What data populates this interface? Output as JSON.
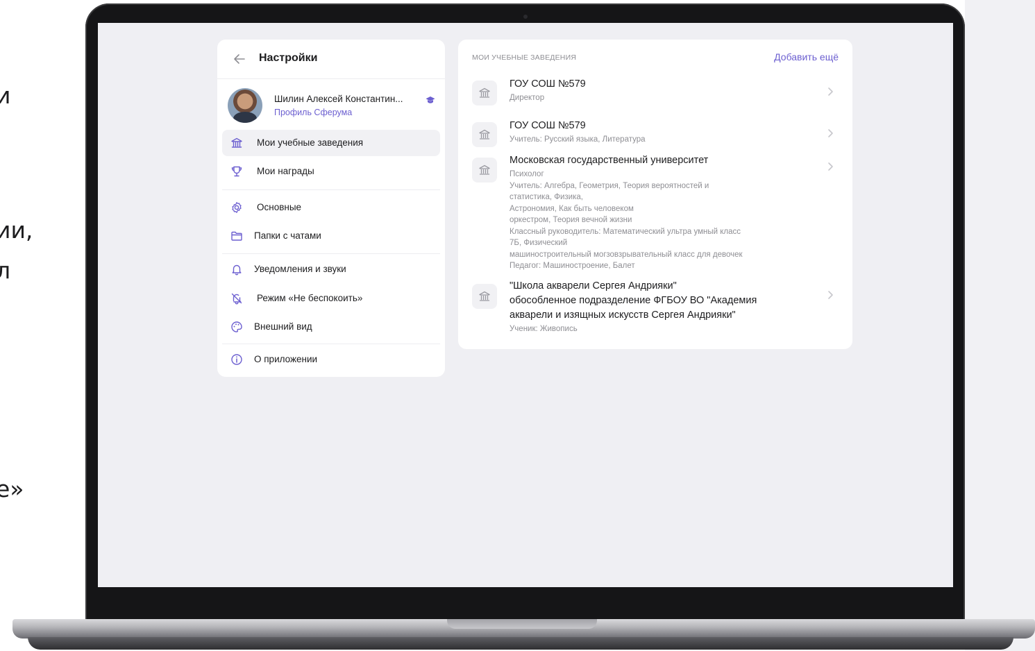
{
  "background_fragments": [
    "и",
    "ии,",
    "л",
    "е»"
  ],
  "settings": {
    "title": "Настройки",
    "user_name": "Шилин Алексей Константин...",
    "profile_link": "Профиль Сферума",
    "menu": [
      {
        "label": "Мои учебные заведения",
        "icon": "school-icon",
        "active": true
      },
      {
        "label": "Мои награды",
        "icon": "trophy-icon"
      },
      {
        "label": "Основные",
        "icon": "gear-icon"
      },
      {
        "label": "Папки с чатами",
        "icon": "folder-icon"
      },
      {
        "label": "Уведомления и звуки",
        "icon": "bell-icon"
      },
      {
        "label": "Режим «Не беспокоить»",
        "icon": "bell-off-icon"
      },
      {
        "label": "Внешний вид",
        "icon": "palette-icon"
      },
      {
        "label": "О приложении",
        "icon": "info-icon"
      }
    ]
  },
  "institutions": {
    "header": "МОИ УЧЕБНЫЕ ЗАВЕДЕНИЯ",
    "add_label": "Добавить ещё",
    "items": [
      {
        "name_lines": [
          "ГОУ СОШ №579"
        ],
        "details": [
          "Директор"
        ]
      },
      {
        "name_lines": [
          "ГОУ СОШ №579"
        ],
        "details": [
          "Учитель: Русский языка, Литература"
        ]
      },
      {
        "name_lines": [
          "Московская государственный университет"
        ],
        "details": [
          "Психолог",
          "Учитель: Алгебра, Геометрия, Теория вероятностей и",
          "статистика, Физика,",
          "Астрономия, Как быть человеком",
          "оркестром, Теория вечной жизни",
          "Классный  руководитель: Математический ультра умный класс",
          "7Б, Физический",
          "машиностроительный могзовзрывательный класс для девочек",
          "Педагог: Машиностроение, Балет"
        ]
      },
      {
        "name_lines": [
          "\"Школа акварели Сергея Андрияки\"",
          "обособленное подразделение ФГБОУ ВО \"Академия",
          "акварели и изящных искусств Сергея Андрияки\""
        ],
        "details": [
          "Ученик: Живопись"
        ]
      }
    ]
  },
  "colors": {
    "accent": "#6c5fd0",
    "screen_bg": "#efeff3",
    "text_primary": "#1c1c1e",
    "text_secondary": "#8e8e93"
  }
}
